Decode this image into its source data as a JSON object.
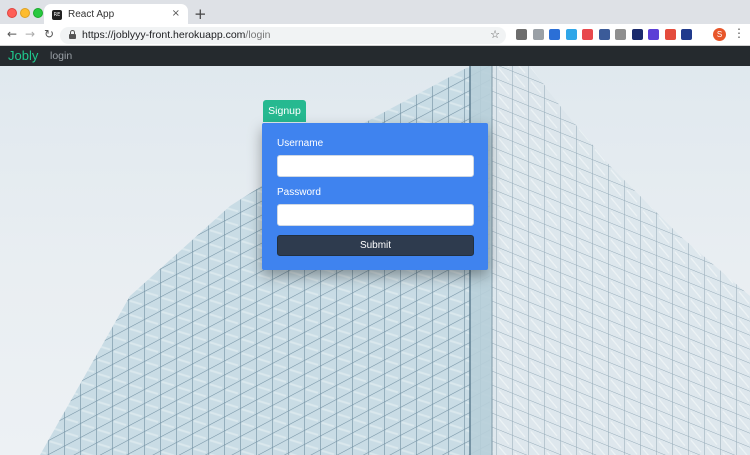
{
  "browser": {
    "tab_title": "React App",
    "favicon_text": "RE",
    "tab_close": "×",
    "new_tab": "+",
    "url_host": "https://joblyyy-front.herokuapp.com",
    "url_path": "/login",
    "avatar_letter": "S",
    "extension_colors": [
      "#6d6d6d",
      "#9aa0a6",
      "#2b6fd6",
      "#2fa6e8",
      "#e8484d",
      "#3b5b99",
      "#8f8f8f",
      "#1a2a6c",
      "#5b3fd6",
      "#e44b3c",
      "#203a8c"
    ]
  },
  "navbar": {
    "brand": "Jobly",
    "brand_color": "#1fc98e",
    "login_link": "login"
  },
  "form": {
    "signup_tab": "Signup",
    "username_label": "Username",
    "username_value": "",
    "password_label": "Password",
    "password_value": "",
    "submit_label": "Submit",
    "card_color": "#3f83ef",
    "tab_color": "#26b990",
    "button_color": "#2e3b4e"
  }
}
